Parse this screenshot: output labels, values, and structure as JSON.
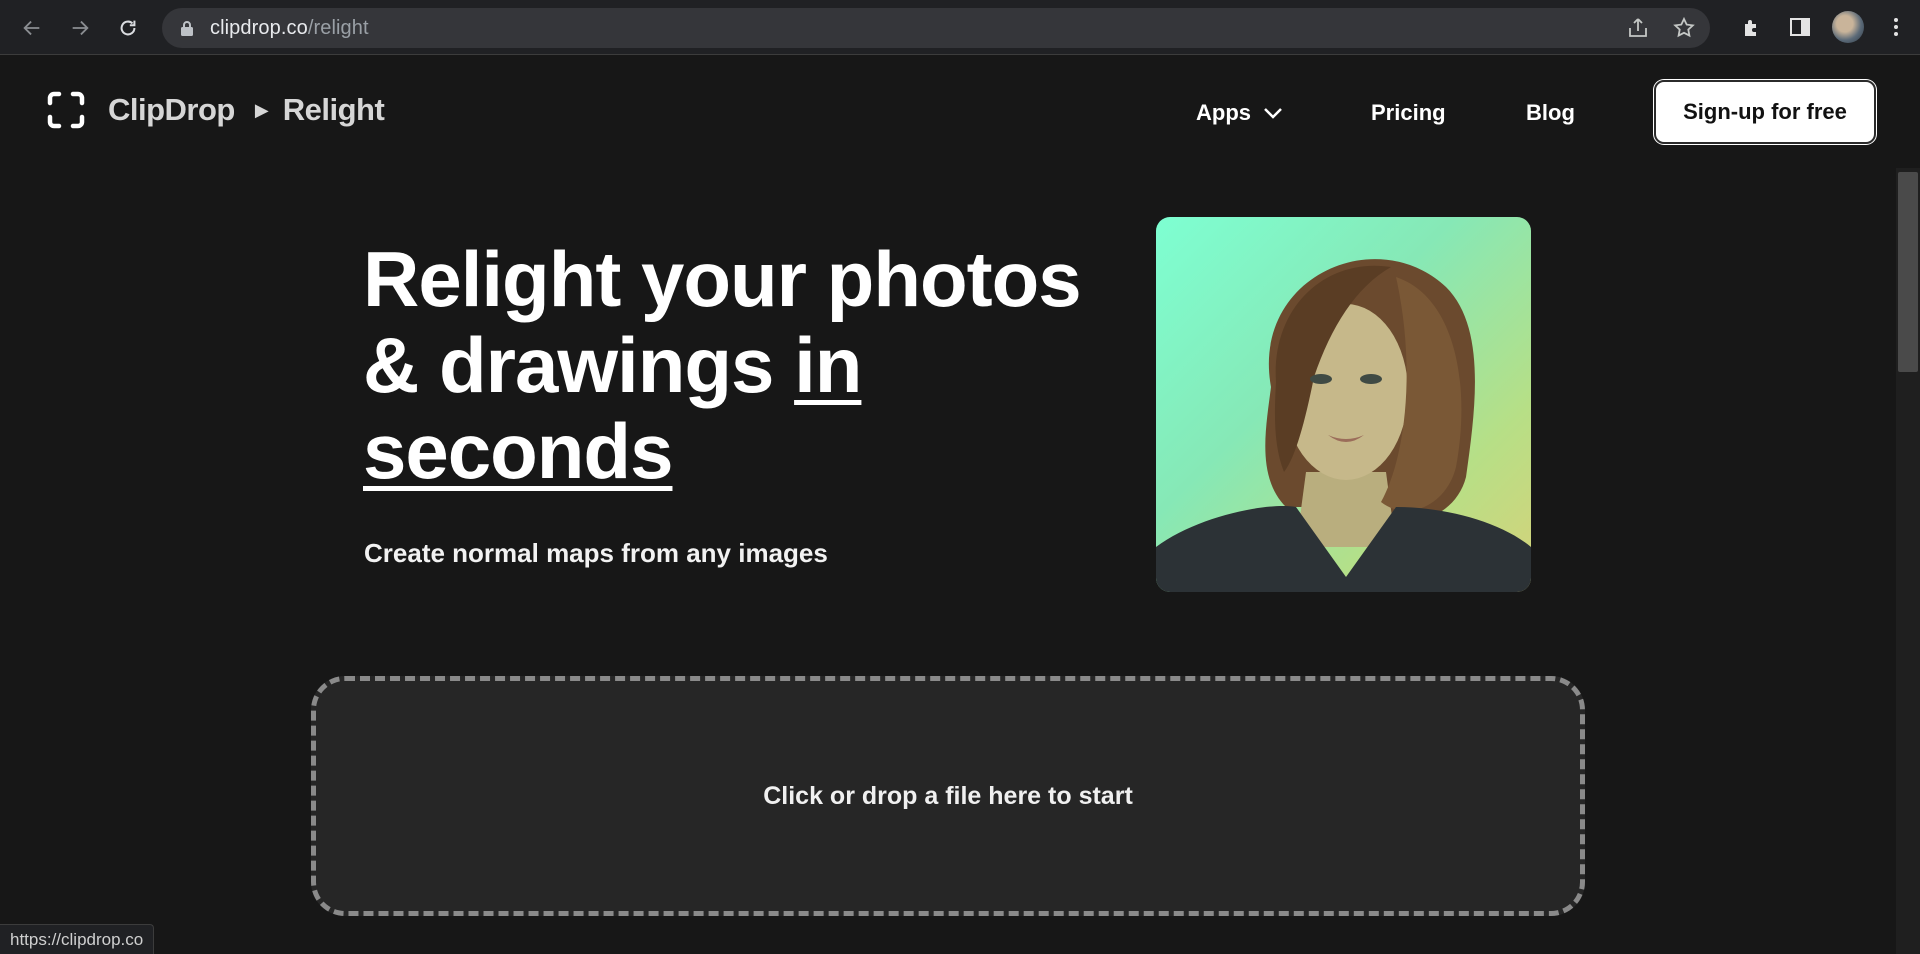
{
  "browser": {
    "url_host": "clipdrop.co",
    "url_path": "/relight",
    "status_url": "https://clipdrop.co"
  },
  "header": {
    "brand": "ClipDrop",
    "separator": "▶",
    "breadcrumb": "Relight",
    "nav": {
      "apps": "Apps",
      "pricing": "Pricing",
      "blog": "Blog"
    },
    "signup": "Sign-up for free"
  },
  "hero": {
    "title_line1": "Relight your photos",
    "title_line2_plain": "& drawings ",
    "title_line2_underlined": "in",
    "title_line3_underlined": "seconds",
    "subtitle": "Create normal maps from any images"
  },
  "upload": {
    "prompt": "Click or drop a file here to start"
  },
  "colors": {
    "page_bg": "#171717",
    "dropzone_bg": "#262626",
    "dropzone_border": "#8a8a8a"
  }
}
